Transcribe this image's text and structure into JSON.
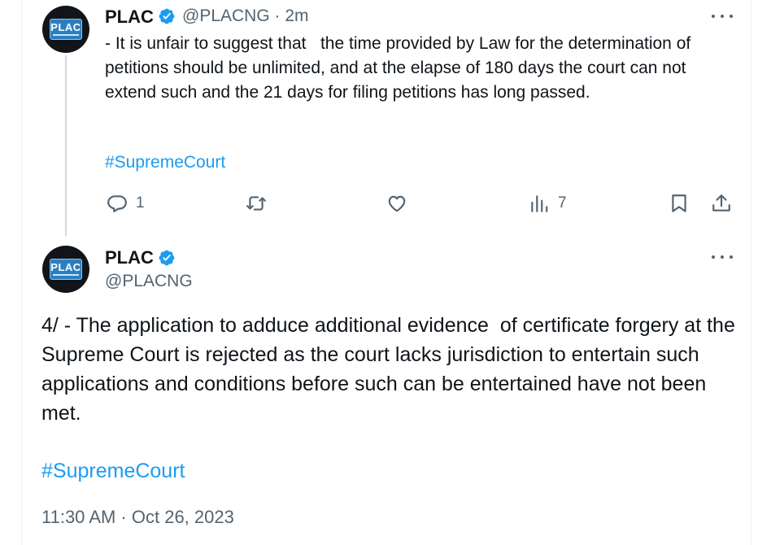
{
  "tweet1": {
    "name": "PLAC",
    "handle": "@PLACNG",
    "separator": "·",
    "time": "2m",
    "text": "- It is unfair to suggest that   the time provided by Law for the determination of petitions should be unlimited, and at the elapse of 180 days the court can not  extend such and the 21 days for filing petitions has long passed.",
    "hashtag": "#SupremeCourt",
    "replies": "1",
    "views": "7"
  },
  "tweet2": {
    "name": "PLAC",
    "handle": "@PLACNG",
    "text": "4/ - The application to adduce additional evidence  of certificate forgery at the Supreme Court is rejected as the court lacks jurisdiction to entertain such applications and conditions before such can be entertained have not been met.",
    "hashtag": "#SupremeCourt",
    "timestamp": "11:30 AM · Oct 26, 2023"
  },
  "avatar": {
    "logo_text": "PLAC"
  },
  "colors": {
    "link": "#1d9bf0",
    "secondary_text": "#536471",
    "verified": "#1d9bf0",
    "thread_line": "#cfd9de"
  },
  "icons": {
    "reply": "reply-icon",
    "retweet": "retweet-icon",
    "like": "heart-icon",
    "views": "views-icon",
    "bookmark": "bookmark-icon",
    "share": "share-icon",
    "more": "more-icon",
    "verified": "verified-badge-icon"
  }
}
